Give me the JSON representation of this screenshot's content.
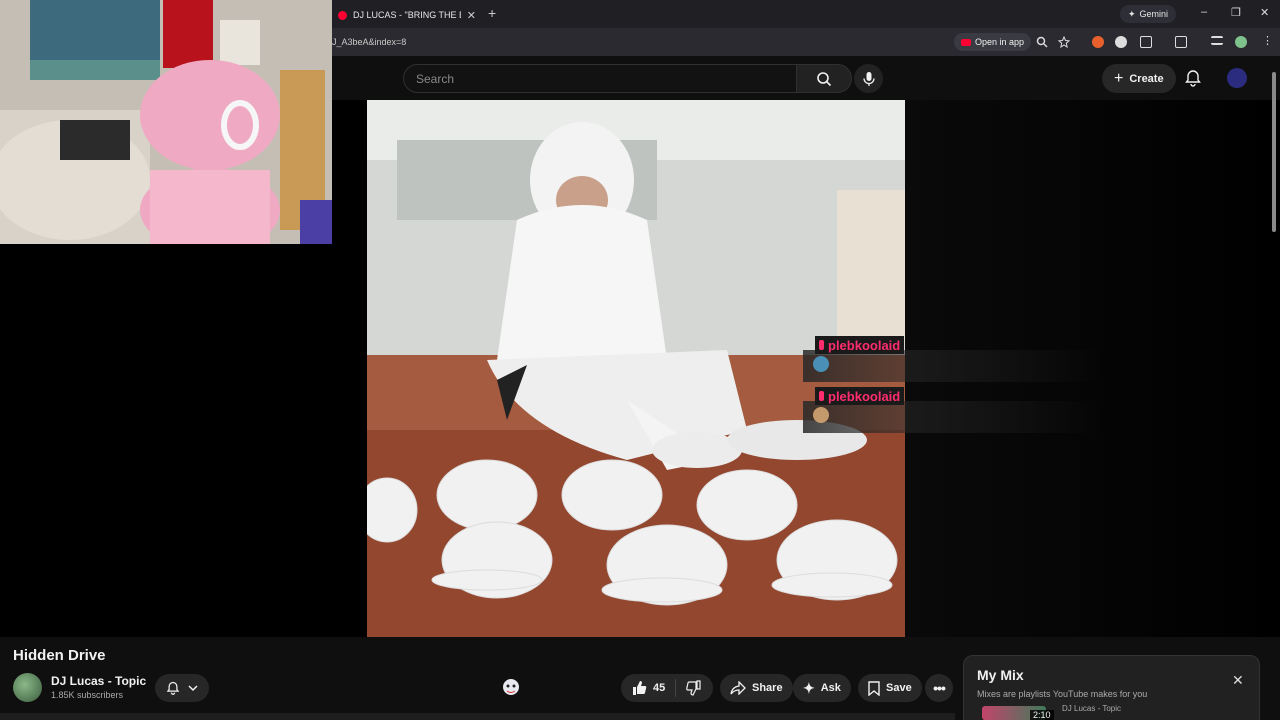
{
  "browser": {
    "tab_title": "DJ LUCAS - \"BRING THE BOOM",
    "tab_close": "✕",
    "new_tab": "+",
    "gemini_label": "Gemini",
    "url": "J_A3beA&index=8",
    "open_in_app": "Open in app"
  },
  "header": {
    "search_placeholder": "Search",
    "create_label": "Create"
  },
  "chat": [
    {
      "username": "plebkoolaid"
    },
    {
      "username": "plebkoolaid"
    }
  ],
  "video": {
    "title": "Hidden Drive",
    "channel_name": "DJ Lucas - Topic",
    "subscribers": "1.85K subscribers",
    "like_count": "45",
    "share_label": "Share",
    "ask_label": "Ask",
    "save_label": "Save"
  },
  "mix": {
    "title": "My Mix",
    "subtitle": "Mixes are playlists YouTube makes for you",
    "item_duration": "2:10",
    "item_channel": "DJ Lucas - Topic"
  },
  "colors": {
    "youtube_red": "#ff0033",
    "chat_name": "#ff2d6e",
    "background": "#0f0f0f",
    "pill_bg": "#272727"
  },
  "icons": [
    "youtube-icon",
    "search-icon",
    "mic-icon",
    "plus-icon",
    "bell-icon",
    "like-icon",
    "dislike-icon",
    "share-icon",
    "ask-icon",
    "save-icon",
    "more-icon",
    "close-icon",
    "chevron-down-icon"
  ]
}
